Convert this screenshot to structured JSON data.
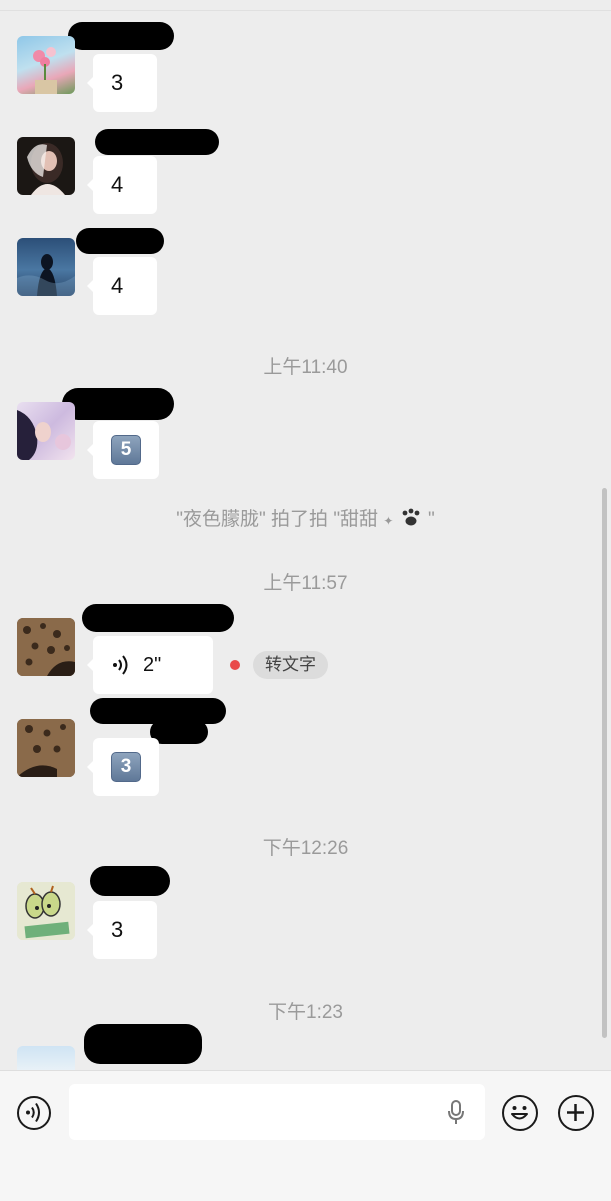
{
  "messages": [
    {
      "id": "m1",
      "content": "3"
    },
    {
      "id": "m2",
      "content": "4"
    },
    {
      "id": "m3",
      "content": "4"
    },
    {
      "id": "m4",
      "content": "5"
    },
    {
      "id": "m5",
      "voice_duration": "2\"",
      "to_text_label": "转文字"
    },
    {
      "id": "m6",
      "content": "3"
    },
    {
      "id": "m7",
      "content": "3"
    }
  ],
  "timestamps": {
    "t1": "上午11:40",
    "t2": "上午11:57",
    "t3": "下午12:26",
    "t4": "下午1:23"
  },
  "system_note": "\"夜色朦胧\" 拍了拍 \"甜甜",
  "system_note_end": "\"",
  "icons": {
    "voice_toggle": "voice-icon",
    "mic": "microphone-icon",
    "emoji": "emoji-icon",
    "plus": "plus-icon",
    "paw": "paw-icon"
  },
  "colors": {
    "background": "#ededed",
    "bubble": "#ffffff",
    "timestamp_text": "#9a9a9a",
    "unread_dot": "#e94a4a"
  }
}
